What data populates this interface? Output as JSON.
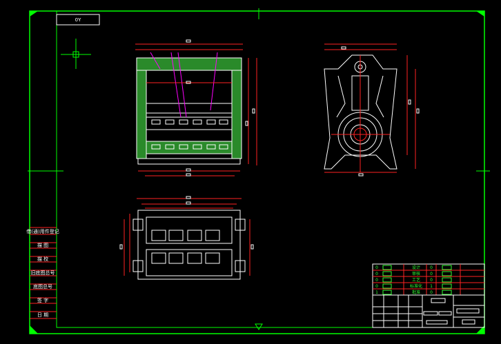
{
  "drawing": {
    "title_stamp": "0Y",
    "colors": {
      "frame": "#00ff00",
      "dimension": "#ff2020",
      "outline": "#ffffff",
      "hatch": "#2fbf2f",
      "magenta": "#ff00ff"
    }
  },
  "left_table": {
    "rows": [
      "借(通)用件登记",
      "描 图",
      "描 校",
      "旧底图总号",
      "底图总号",
      "签 字",
      "日 期"
    ]
  },
  "title_block": {
    "rows": [
      "设计",
      "审核",
      "工艺",
      "标准化",
      "批准"
    ],
    "counts": [
      "0",
      "0",
      "0",
      "0",
      "1"
    ],
    "right_counts": [
      "0",
      "0",
      "0",
      "1",
      "0"
    ]
  }
}
